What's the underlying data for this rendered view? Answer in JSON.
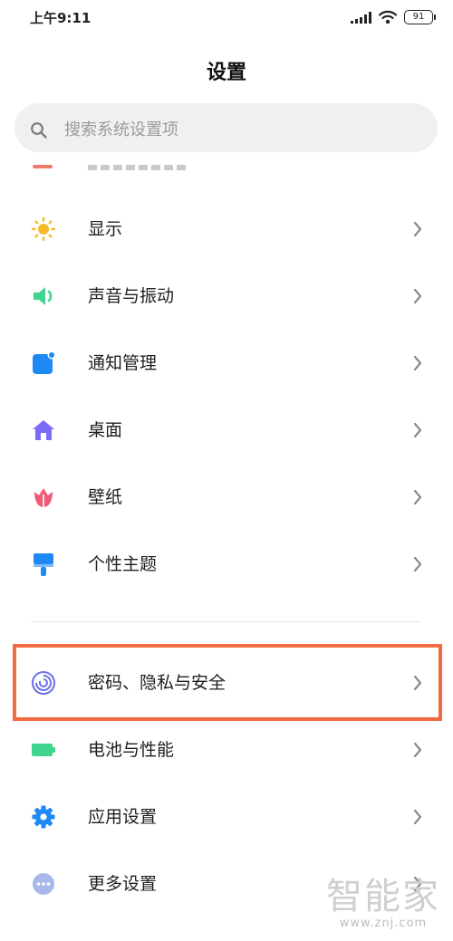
{
  "status_bar": {
    "time": "上午9:11",
    "battery": "91"
  },
  "page": {
    "title": "设置"
  },
  "search": {
    "placeholder": "搜索系统设置项"
  },
  "menu": [
    {
      "label": "显示",
      "icon": "sun-icon",
      "color": "#F5BB2A"
    },
    {
      "label": "声音与振动",
      "icon": "speaker-icon",
      "color": "#3FD58F"
    },
    {
      "label": "通知管理",
      "icon": "notification-icon",
      "color": "#1E88F5"
    },
    {
      "label": "桌面",
      "icon": "home-icon",
      "color": "#7B6CF6"
    },
    {
      "label": "壁纸",
      "icon": "tulip-icon",
      "color": "#EE5A78"
    },
    {
      "label": "个性主题",
      "icon": "brush-icon",
      "color": "#1E88F5"
    },
    {
      "label": "密码、隐私与安全",
      "icon": "fingerprint-icon",
      "color": "#6B6FE8"
    },
    {
      "label": "电池与性能",
      "icon": "battery-icon",
      "color": "#3FD58F"
    },
    {
      "label": "应用设置",
      "icon": "gear-icon",
      "color": "#1E88F5"
    },
    {
      "label": "更多设置",
      "icon": "more-icon",
      "color": "#A9B8EA"
    }
  ],
  "highlight": {
    "target": "密码、隐私与安全",
    "color": "#F26A3F"
  },
  "watermark": {
    "logo": "智能家",
    "url": "www.znj.com"
  }
}
